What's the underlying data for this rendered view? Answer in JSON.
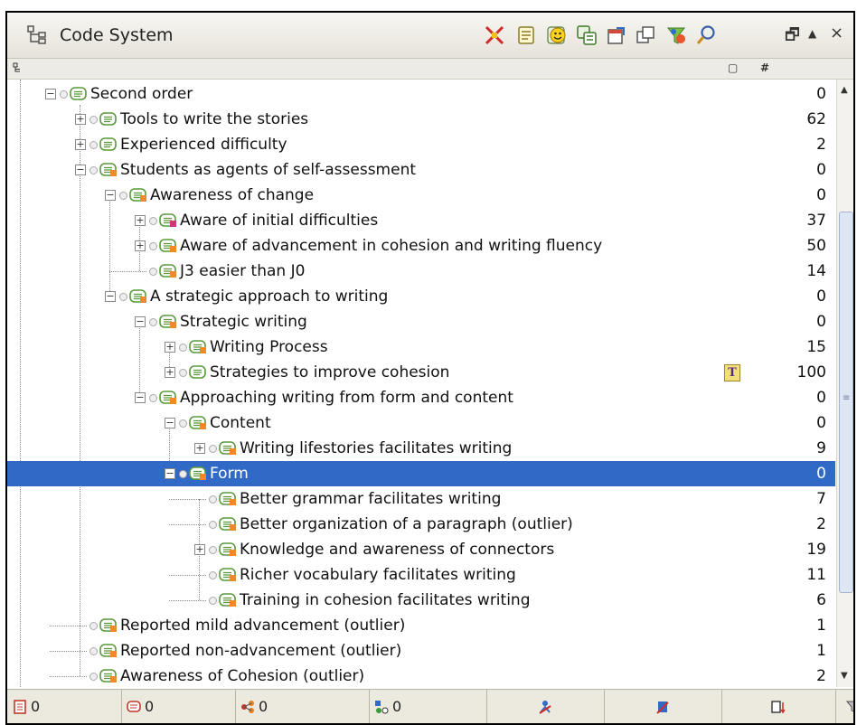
{
  "window": {
    "title": "Code System",
    "restore_glyph": "🗗",
    "minimize_glyph": "▲",
    "close_glyph": "×"
  },
  "columns": {
    "box": "▢",
    "count": "#"
  },
  "rows": [
    {
      "label": "Second order",
      "count": "0"
    },
    {
      "label": "Tools to write the stories",
      "count": "62"
    },
    {
      "label": "Experienced difficulty",
      "count": "2"
    },
    {
      "label": "Students as agents of self-assessment",
      "count": "0"
    },
    {
      "label": "Awareness of change",
      "count": "0"
    },
    {
      "label": "Aware of initial difficulties",
      "count": "37"
    },
    {
      "label": "Aware of advancement in cohesion and writing fluency",
      "count": "50"
    },
    {
      "label": "J3 easier than J0",
      "count": "14"
    },
    {
      "label": "A strategic approach to writing",
      "count": "0"
    },
    {
      "label": "Strategic writing",
      "count": "0"
    },
    {
      "label": "Writing Process",
      "count": "15"
    },
    {
      "label": "Strategies to improve cohesion",
      "count": "100",
      "badge": "T"
    },
    {
      "label": "Approaching writing from form and content",
      "count": "0"
    },
    {
      "label": "Content",
      "count": "0"
    },
    {
      "label": "Writing lifestories facilitates writing",
      "count": "9"
    },
    {
      "label": "Form",
      "count": "0"
    },
    {
      "label": "Better grammar facilitates writing",
      "count": "7"
    },
    {
      "label": "Better organization of a paragraph (outlier)",
      "count": "2"
    },
    {
      "label": "Knowledge and awareness of connectors",
      "count": "19"
    },
    {
      "label": "Richer vocabulary facilitates writing",
      "count": "11"
    },
    {
      "label": "Training in cohesion facilitates writing",
      "count": "6"
    },
    {
      "label": "Reported mild advancement (outlier)",
      "count": "1"
    },
    {
      "label": "Reported non-advancement (outlier)",
      "count": "1"
    },
    {
      "label": "Awareness of Cohesion (outlier)",
      "count": "2"
    }
  ],
  "statusbar": {
    "cells": [
      {
        "value": "0",
        "icon": "documents-icon"
      },
      {
        "value": "0",
        "icon": "codes-icon"
      },
      {
        "value": "0",
        "icon": "links-icon"
      },
      {
        "value": "0",
        "icon": "variables-icon"
      },
      {
        "value": "",
        "icon": "filter-users-icon"
      },
      {
        "value": "",
        "icon": "filter-codes-icon"
      },
      {
        "value": "",
        "icon": "sort-icon"
      },
      {
        "value": "",
        "icon": "funnel-icon"
      }
    ]
  },
  "colors": {
    "selection": "#3169c6",
    "orange_marker": "#f08a24",
    "magenta_marker": "#d6337a",
    "code_green": "#5a9a3a"
  }
}
